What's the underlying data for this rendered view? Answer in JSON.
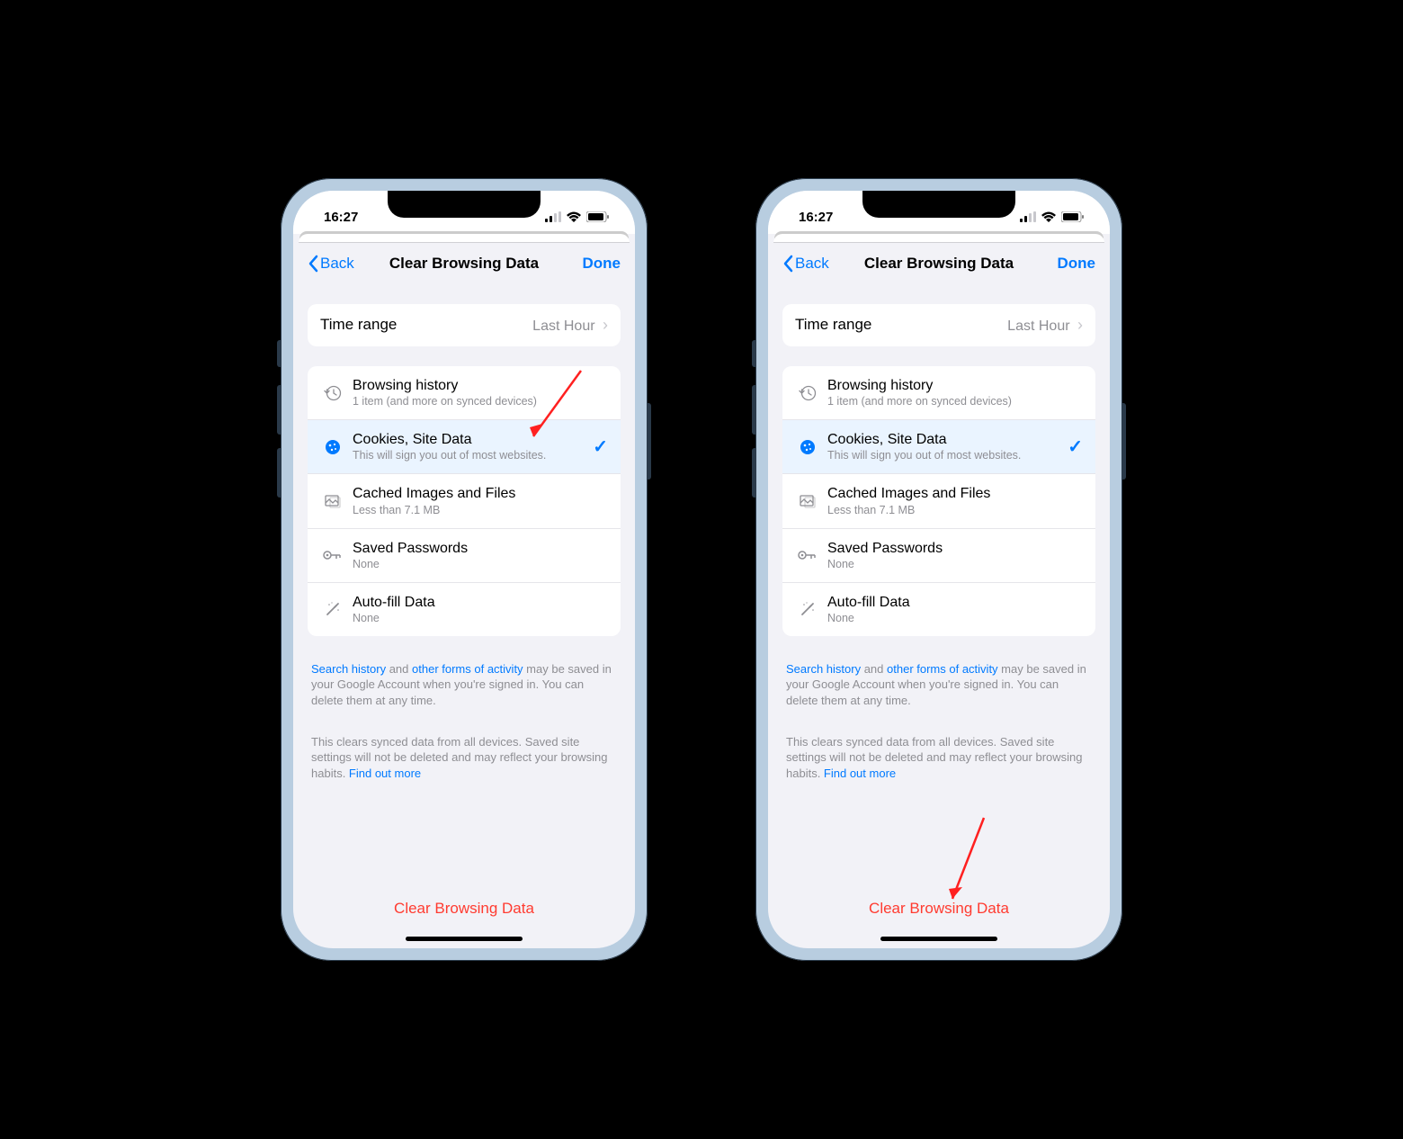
{
  "status": {
    "time": "16:27"
  },
  "nav": {
    "back": "Back",
    "title": "Clear Browsing Data",
    "done": "Done"
  },
  "time_range": {
    "label": "Time range",
    "value": "Last Hour"
  },
  "items": [
    {
      "title": "Browsing history",
      "sub": "1 item (and more on synced devices)",
      "selected": false
    },
    {
      "title": "Cookies, Site Data",
      "sub": "This will sign you out of most websites.",
      "selected": true
    },
    {
      "title": "Cached Images and Files",
      "sub": "Less than 7.1 MB",
      "selected": false
    },
    {
      "title": "Saved Passwords",
      "sub": "None",
      "selected": false
    },
    {
      "title": "Auto-fill Data",
      "sub": "None",
      "selected": false
    }
  ],
  "info1": {
    "link1": "Search history",
    "mid1": " and ",
    "link2": "other forms of activity",
    "rest": " may be saved in your Google Account when you're signed in. You can delete them at any time."
  },
  "info2": {
    "text": "This clears synced data from all devices. Saved site settings will not be deleted and may reflect your browsing habits. ",
    "link": "Find out more"
  },
  "clear_button": "Clear Browsing Data"
}
